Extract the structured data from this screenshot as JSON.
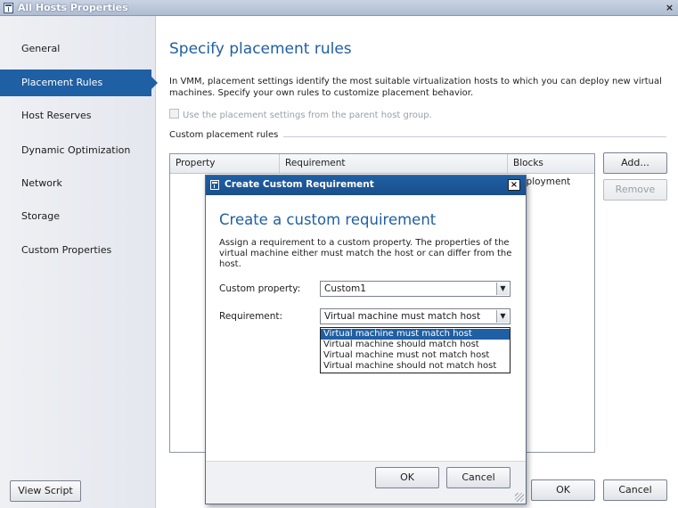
{
  "window": {
    "title": "All Hosts Properties",
    "close_glyph": "×"
  },
  "sidebar": {
    "items": [
      {
        "label": "General"
      },
      {
        "label": "Placement Rules"
      },
      {
        "label": "Host Reserves"
      },
      {
        "label": "Dynamic Optimization"
      },
      {
        "label": "Network"
      },
      {
        "label": "Storage"
      },
      {
        "label": "Custom Properties"
      }
    ],
    "active_index": 1,
    "view_script_label": "View Script"
  },
  "main": {
    "title": "Specify placement rules",
    "description": "In VMM, placement settings identify the most suitable virtualization hosts to which you can deploy new virtual machines. Specify your own rules to customize placement behavior.",
    "parent_checkbox_label": "Use the placement settings from the parent host group.",
    "group_label": "Custom placement rules",
    "columns": [
      "Property",
      "Requirement",
      "Blocks Deployment"
    ],
    "add_label": "Add...",
    "remove_label": "Remove",
    "ok_label": "OK",
    "cancel_label": "Cancel"
  },
  "dialog": {
    "title": "Create Custom Requirement",
    "close_glyph": "×",
    "heading": "Create a custom requirement",
    "description": "Assign a requirement to a custom property. The properties of the virtual machine either must match the host or can differ from the host.",
    "custom_property_label": "Custom property:",
    "custom_property_value": "Custom1",
    "requirement_label": "Requirement:",
    "requirement_value": "Virtual machine must match host",
    "requirement_options": [
      "Virtual machine must match host",
      "Virtual machine should match host",
      "Virtual machine must not match host",
      "Virtual machine should not match host"
    ],
    "selected_option_index": 0,
    "ok_label": "OK",
    "cancel_label": "Cancel"
  },
  "colors": {
    "accent": "#1f5fa3",
    "title_gradient": "#aebcd2"
  },
  "icons": {
    "window_icon": "window-icon",
    "dropdown_arrow": "chevron-down-icon"
  }
}
